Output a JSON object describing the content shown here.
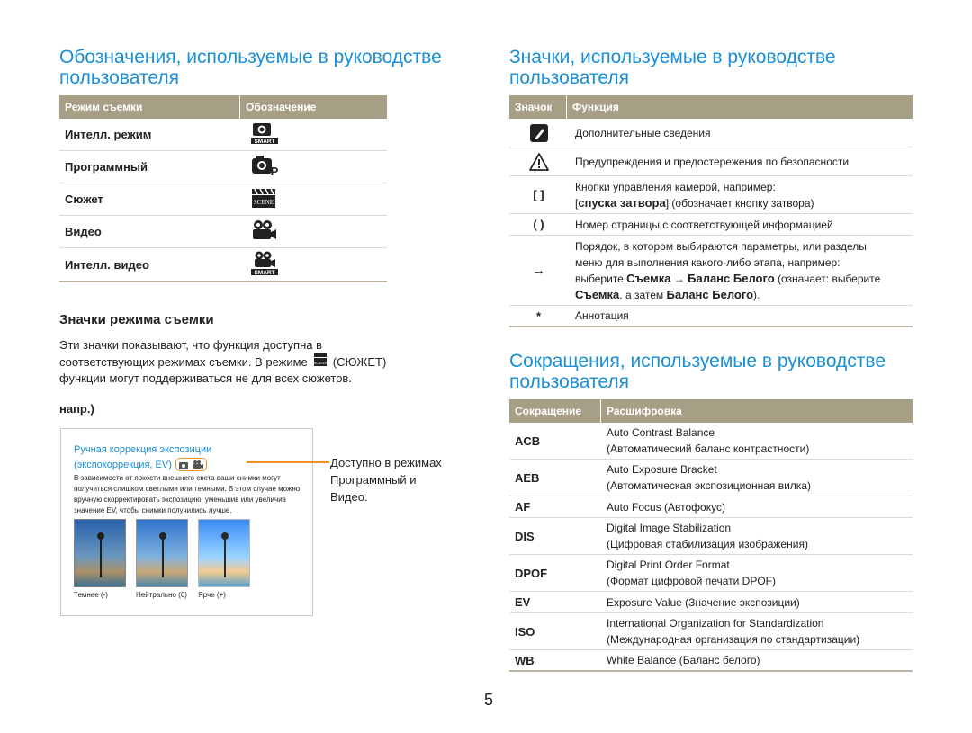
{
  "left": {
    "title": "Обозначения, используемые в руководстве пользователя",
    "mode_table": {
      "headers": [
        "Режим съемки",
        "Обозначение"
      ],
      "rows": [
        {
          "name": "Интелл. режим",
          "icon": "smart-auto-icon"
        },
        {
          "name": "Программный",
          "icon": "program-camera-icon"
        },
        {
          "name": "Сюжет",
          "icon": "scene-clapper-icon"
        },
        {
          "name": "Видео",
          "icon": "video-camera-icon"
        },
        {
          "name": "Интелл. видео",
          "icon": "smart-video-icon"
        }
      ]
    },
    "subheading": "Значки режима съемки",
    "paragraph_1": "Эти значки показывают, что функция доступна в",
    "paragraph_2a": "соответствующих режимах съемки. В режиме",
    "paragraph_2b": "(СЮЖЕТ)",
    "paragraph_3": "функции могут поддерживаться не для всех сюжетов.",
    "example_label": "напр.)",
    "example": {
      "title_1": "Ручная коррекция экспозиции",
      "title_2": "(экспокоррекция, EV)",
      "text": "В зависимости от яркости внешнего света ваши снимки могут получиться слишком светлыми или темными. В этом случае можно вручную скорректировать экспозицию, уменьшив или увеличив значение EV, чтобы снимки получились лучше.",
      "captions": [
        "Темнее (-)",
        "Нейтрально (0)",
        "Ярче (+)"
      ],
      "callout_1": "Доступно в режимах",
      "callout_2": "Программный и",
      "callout_3": "Видео."
    }
  },
  "right": {
    "icons_title": "Значки, используемые в руководстве пользователя",
    "icons_table": {
      "headers": [
        "Значок",
        "Функция"
      ],
      "rows": [
        {
          "icon": "note-icon",
          "text": "Дополнительные сведения"
        },
        {
          "icon": "warning-icon",
          "text": "Предупреждения и предостережения по безопасности"
        },
        {
          "symbol": "[ ]",
          "text_1": "Кнопки управления камерой, например:",
          "text_2a": "[",
          "text_2b": "спуска затвора",
          "text_2c": "] (обозначает кнопку затвора)"
        },
        {
          "symbol": "( )",
          "text": "Номер страницы с соответствующей информацией"
        },
        {
          "symbol": "→",
          "text_1": "Порядок, в котором выбираются параметры, или разделы",
          "text_2": "меню для выполнения какого-либо этапа, например:",
          "text_3a": "выберите ",
          "text_3b": "Съемка",
          "text_3c": " → ",
          "text_3d": "Баланс Белого",
          "text_3e": " (означает: выберите",
          "text_4a": "Съемка",
          "text_4b": ", а затем ",
          "text_4c": "Баланс Белого",
          "text_4d": ")."
        },
        {
          "symbol": "*",
          "text": "Аннотация"
        }
      ]
    },
    "abbr_title": "Сокращения, используемые в руководстве пользователя",
    "abbr_table": {
      "headers": [
        "Сокращение",
        "Расшифровка"
      ],
      "rows": [
        {
          "abbr": "ACB",
          "line1": "Auto Contrast Balance",
          "line2": "(Автоматический баланс контрастности)"
        },
        {
          "abbr": "AEB",
          "line1": "Auto Exposure Bracket",
          "line2": "(Автоматическая экспозиционная вилка)"
        },
        {
          "abbr": "AF",
          "line1": "Auto Focus (Автофокус)"
        },
        {
          "abbr": "DIS",
          "line1": "Digital Image Stabilization",
          "line2": "(Цифровая стабилизация изображения)"
        },
        {
          "abbr": "DPOF",
          "line1": "Digital Print Order Format",
          "line2": "(Формат цифровой печати DPOF)"
        },
        {
          "abbr": "EV",
          "line1": "Exposure Value (Значение экспозиции)"
        },
        {
          "abbr": "ISO",
          "line1": "International Organization for Standardization",
          "line2": "(Международная организация по стандартизации)"
        },
        {
          "abbr": "WB",
          "line1": "White Balance (Баланс белого)"
        }
      ]
    }
  },
  "page_number": "5",
  "colors": {
    "accent_blue": "#1a8fd6",
    "header_bg": "#a79e86",
    "callout_orange": "#f0931e"
  }
}
